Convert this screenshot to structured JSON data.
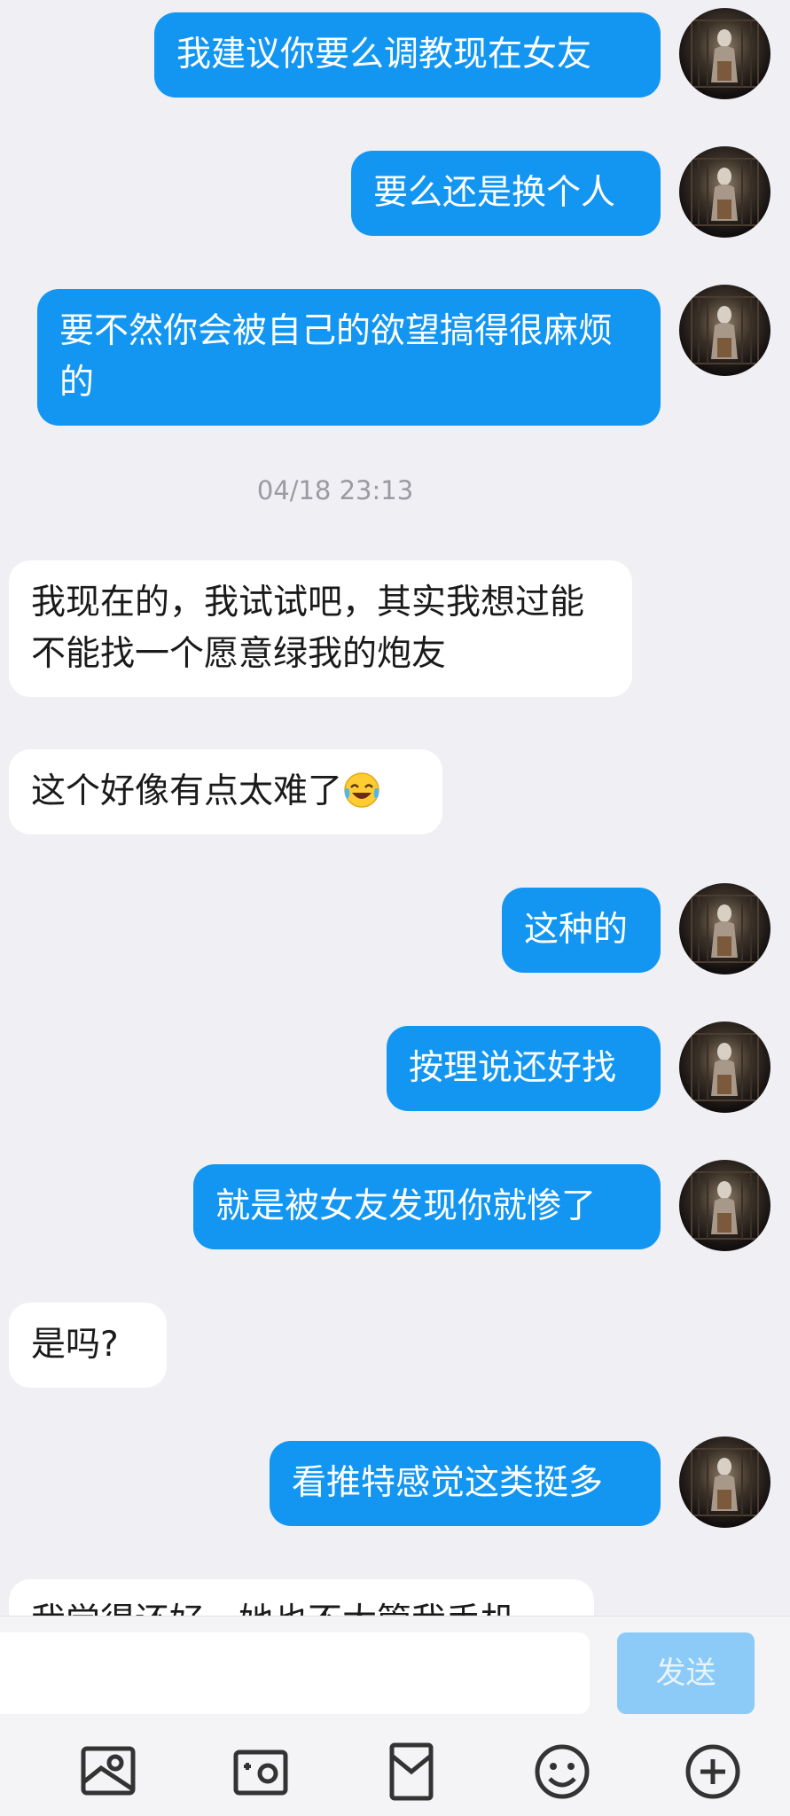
{
  "messages": [
    {
      "side": "out",
      "text": "我建议你要么调教现在女友"
    },
    {
      "side": "out",
      "text": "要么还是换个人"
    },
    {
      "side": "out",
      "text": "要不然你会被自己的欲望搞得很麻烦的"
    },
    {
      "side": "in",
      "text": "我现在的，我试试吧，其实我想过能不能找一个愿意绿我的炮友"
    },
    {
      "side": "in",
      "text": "这个好像有点太难了"
    },
    {
      "side": "out",
      "text": "这种的"
    },
    {
      "side": "out",
      "text": "按理说还好找"
    },
    {
      "side": "out",
      "text": "就是被女友发现你就惨了"
    },
    {
      "side": "in",
      "text": "是吗?"
    },
    {
      "side": "out",
      "text": "看推特感觉这类挺多"
    },
    {
      "side": "in",
      "text": "我觉得还好，她也不太管我手机"
    }
  ],
  "timestamp": "04/18 23:13",
  "input": {
    "value": "",
    "send_label": "发送"
  },
  "toolbar": {
    "icons": [
      "image-icon",
      "camera-icon",
      "red-packet-icon",
      "emoji-icon",
      "plus-icon"
    ]
  },
  "colors": {
    "outgoing_bubble": "#1296f2",
    "incoming_bubble": "#ffffff",
    "background": "#efeff4",
    "send_button": "#8ccaf7"
  }
}
